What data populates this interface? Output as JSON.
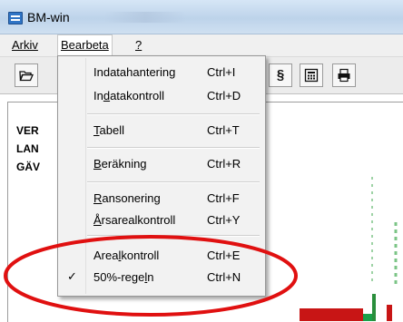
{
  "window": {
    "title": "BM-win",
    "accent": "#2f74c5"
  },
  "menubar": {
    "items": [
      {
        "label": "Arkiv"
      },
      {
        "label": "Bearbeta"
      },
      {
        "label": "?"
      }
    ]
  },
  "toolbar": {
    "buttons": [
      {
        "icon": "folder-open-icon",
        "glyph": "🗁"
      },
      {
        "icon": "section-icon",
        "glyph": "§"
      },
      {
        "icon": "calculator-icon",
        "glyph": "▦"
      },
      {
        "icon": "printer-icon",
        "glyph": "🖶"
      }
    ]
  },
  "workarea": {
    "labels": [
      "VER",
      "LAN",
      "GÄV"
    ]
  },
  "dropdown": {
    "items": [
      {
        "pre": "Indatahantering",
        "shortcut": "Ctrl+I"
      },
      {
        "pre": "In",
        "ul": "d",
        "post": "atakontroll",
        "shortcut": "Ctrl+D"
      },
      {
        "ul": "T",
        "post": "abell",
        "shortcut": "Ctrl+T"
      },
      {
        "ul": "B",
        "post": "eräkning",
        "shortcut": "Ctrl+R"
      },
      {
        "ul": "R",
        "post": "ansonering",
        "shortcut": "Ctrl+F"
      },
      {
        "ul": "Å",
        "post": "rsarealkontroll",
        "shortcut": "Ctrl+Y"
      },
      {
        "pre": "Area",
        "ul": "l",
        "post": "kontroll",
        "shortcut": "Ctrl+E"
      },
      {
        "pre": "50%-rege",
        "ul": "l",
        "post": "n",
        "shortcut": "Ctrl+N",
        "checked": true
      }
    ]
  },
  "annotation": {
    "color": "#e01010"
  }
}
